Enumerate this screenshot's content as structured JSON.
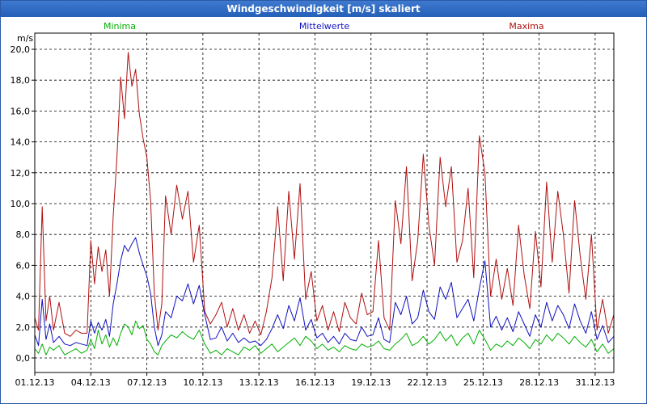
{
  "window": {
    "title": "Windgeschwindigkeit [m/s] skaliert"
  },
  "chart_data": {
    "type": "line",
    "title": "Windgeschwindigkeit [m/s] skaliert",
    "ylabel": "m/s",
    "xlabel": "",
    "ylim": [
      0,
      20
    ],
    "y_ticks": [
      "0,0",
      "2,0",
      "4,0",
      "6,0",
      "8,0",
      "10,0",
      "12,0",
      "14,0",
      "16,0",
      "18,0",
      "20,0"
    ],
    "x_ticks": [
      "01.12.13",
      "04.12.13",
      "07.12.13",
      "10.12.13",
      "13.12.13",
      "16.12.13",
      "19.12.13",
      "22.12.13",
      "25.12.13",
      "28.12.13",
      "31.12.13"
    ],
    "x_tick_days": [
      1,
      4,
      7,
      10,
      13,
      16,
      19,
      22,
      25,
      28,
      31
    ],
    "x_range_days": [
      1,
      32
    ],
    "grid": true,
    "legend_position": "top",
    "series": [
      {
        "name": "Minima",
        "color": "#00b000",
        "x_days": [
          1.0,
          1.2,
          1.4,
          1.6,
          1.8,
          2.0,
          2.3,
          2.6,
          2.9,
          3.2,
          3.5,
          3.8,
          4.0,
          4.2,
          4.4,
          4.6,
          4.8,
          5.0,
          5.2,
          5.4,
          5.6,
          5.8,
          6.0,
          6.2,
          6.4,
          6.6,
          6.8,
          7.0,
          7.2,
          7.4,
          7.6,
          7.8,
          8.0,
          8.3,
          8.6,
          8.9,
          9.2,
          9.5,
          9.8,
          10.1,
          10.4,
          10.7,
          11.0,
          11.3,
          11.6,
          11.9,
          12.2,
          12.5,
          12.8,
          13.1,
          13.4,
          13.7,
          14.0,
          14.3,
          14.6,
          14.9,
          15.2,
          15.5,
          15.8,
          16.1,
          16.4,
          16.7,
          17.0,
          17.3,
          17.6,
          17.9,
          18.2,
          18.5,
          18.8,
          19.1,
          19.4,
          19.7,
          20.0,
          20.3,
          20.6,
          20.9,
          21.2,
          21.5,
          21.8,
          22.1,
          22.4,
          22.7,
          23.0,
          23.3,
          23.6,
          23.9,
          24.2,
          24.5,
          24.8,
          25.1,
          25.4,
          25.7,
          26.0,
          26.3,
          26.6,
          26.9,
          27.2,
          27.5,
          27.8,
          28.1,
          28.4,
          28.7,
          29.0,
          29.3,
          29.6,
          29.9,
          30.2,
          30.5,
          30.8,
          31.1,
          31.4,
          31.7,
          32.0
        ],
        "values": [
          0.6,
          0.3,
          0.9,
          0.2,
          0.7,
          0.5,
          0.8,
          0.2,
          0.4,
          0.6,
          0.3,
          0.5,
          1.2,
          0.6,
          1.8,
          0.9,
          1.5,
          0.7,
          1.3,
          0.8,
          1.6,
          2.2,
          2.0,
          1.5,
          2.4,
          1.9,
          2.1,
          1.2,
          0.9,
          0.4,
          0.2,
          0.8,
          1.1,
          1.5,
          1.3,
          1.7,
          1.4,
          1.2,
          1.8,
          0.9,
          0.3,
          0.5,
          0.2,
          0.6,
          0.4,
          0.2,
          0.7,
          0.5,
          0.8,
          0.3,
          0.6,
          0.9,
          0.4,
          0.7,
          1.0,
          1.3,
          0.8,
          1.4,
          1.1,
          0.6,
          0.9,
          0.5,
          0.7,
          0.4,
          0.8,
          0.6,
          0.5,
          0.9,
          0.7,
          0.8,
          1.1,
          0.6,
          0.5,
          0.9,
          1.2,
          1.6,
          0.8,
          1.0,
          1.4,
          0.9,
          1.2,
          1.7,
          1.1,
          1.5,
          0.8,
          1.3,
          1.6,
          0.9,
          1.8,
          1.2,
          0.5,
          0.9,
          0.7,
          1.1,
          0.8,
          1.3,
          1.0,
          0.6,
          1.2,
          0.9,
          1.5,
          1.1,
          1.6,
          1.3,
          0.9,
          1.4,
          1.0,
          0.7,
          1.2,
          0.4,
          0.9,
          0.3,
          0.6
        ]
      },
      {
        "name": "Mittelwerte",
        "color": "#1010c0",
        "x_days": [
          1.0,
          1.2,
          1.4,
          1.6,
          1.8,
          2.0,
          2.3,
          2.6,
          2.9,
          3.2,
          3.5,
          3.8,
          4.0,
          4.2,
          4.4,
          4.6,
          4.8,
          5.0,
          5.2,
          5.4,
          5.6,
          5.8,
          6.0,
          6.2,
          6.4,
          6.6,
          6.8,
          7.0,
          7.2,
          7.4,
          7.6,
          7.8,
          8.0,
          8.3,
          8.6,
          8.9,
          9.2,
          9.5,
          9.8,
          10.1,
          10.4,
          10.7,
          11.0,
          11.3,
          11.6,
          11.9,
          12.2,
          12.5,
          12.8,
          13.1,
          13.4,
          13.7,
          14.0,
          14.3,
          14.6,
          14.9,
          15.2,
          15.5,
          15.8,
          16.1,
          16.4,
          16.7,
          17.0,
          17.3,
          17.6,
          17.9,
          18.2,
          18.5,
          18.8,
          19.1,
          19.4,
          19.7,
          20.0,
          20.3,
          20.6,
          20.9,
          21.2,
          21.5,
          21.8,
          22.1,
          22.4,
          22.7,
          23.0,
          23.3,
          23.6,
          23.9,
          24.2,
          24.5,
          24.8,
          25.1,
          25.4,
          25.7,
          26.0,
          26.3,
          26.6,
          26.9,
          27.2,
          27.5,
          27.8,
          28.1,
          28.4,
          28.7,
          29.0,
          29.3,
          29.6,
          29.9,
          30.2,
          30.5,
          30.8,
          31.1,
          31.4,
          31.7,
          32.0
        ],
        "values": [
          1.5,
          0.8,
          3.8,
          1.2,
          2.2,
          1.0,
          1.4,
          0.9,
          0.8,
          1.0,
          0.9,
          0.8,
          2.4,
          1.6,
          2.3,
          1.8,
          2.5,
          1.4,
          3.5,
          4.8,
          6.3,
          7.3,
          6.9,
          7.4,
          7.8,
          6.8,
          6.0,
          5.3,
          4.2,
          2.0,
          0.8,
          1.5,
          3.0,
          2.6,
          4.0,
          3.7,
          4.8,
          3.5,
          4.7,
          2.8,
          1.2,
          1.3,
          2.0,
          1.1,
          1.6,
          1.0,
          1.3,
          1.0,
          1.1,
          0.8,
          1.2,
          1.9,
          2.8,
          1.9,
          3.4,
          2.4,
          3.9,
          1.8,
          2.5,
          1.3,
          1.6,
          1.0,
          1.4,
          0.9,
          1.6,
          1.2,
          1.1,
          2.0,
          1.4,
          1.5,
          2.6,
          1.2,
          1.0,
          3.6,
          2.8,
          4.0,
          2.2,
          2.6,
          4.4,
          3.0,
          2.5,
          4.6,
          3.8,
          4.9,
          2.6,
          3.2,
          3.8,
          2.4,
          4.5,
          6.3,
          2.0,
          2.7,
          1.8,
          2.6,
          1.7,
          3.0,
          2.2,
          1.4,
          2.8,
          2.0,
          3.6,
          2.4,
          3.4,
          2.8,
          1.9,
          3.5,
          2.4,
          1.6,
          3.0,
          1.2,
          2.1,
          1.0,
          1.4
        ]
      },
      {
        "name": "Maxima",
        "color": "#b01010",
        "x_days": [
          1.0,
          1.2,
          1.4,
          1.6,
          1.8,
          2.0,
          2.3,
          2.6,
          2.9,
          3.2,
          3.5,
          3.8,
          4.0,
          4.2,
          4.4,
          4.6,
          4.8,
          5.0,
          5.2,
          5.4,
          5.6,
          5.8,
          6.0,
          6.2,
          6.4,
          6.6,
          6.8,
          7.0,
          7.2,
          7.4,
          7.6,
          7.8,
          8.0,
          8.3,
          8.6,
          8.9,
          9.2,
          9.5,
          9.8,
          10.1,
          10.4,
          10.7,
          11.0,
          11.3,
          11.6,
          11.9,
          12.2,
          12.5,
          12.8,
          13.1,
          13.4,
          13.7,
          14.0,
          14.3,
          14.6,
          14.9,
          15.2,
          15.5,
          15.8,
          16.1,
          16.4,
          16.7,
          17.0,
          17.3,
          17.6,
          17.9,
          18.2,
          18.5,
          18.8,
          19.1,
          19.4,
          19.7,
          20.0,
          20.3,
          20.6,
          20.9,
          21.2,
          21.5,
          21.8,
          22.1,
          22.4,
          22.7,
          23.0,
          23.3,
          23.6,
          23.9,
          24.2,
          24.5,
          24.8,
          25.1,
          25.4,
          25.7,
          26.0,
          26.3,
          26.6,
          26.9,
          27.2,
          27.5,
          27.8,
          28.1,
          28.4,
          28.7,
          29.0,
          29.3,
          29.6,
          29.9,
          30.2,
          30.5,
          30.8,
          31.1,
          31.4,
          31.7,
          32.0
        ],
        "values": [
          2.6,
          1.8,
          9.8,
          2.4,
          4.0,
          1.8,
          3.6,
          1.6,
          1.4,
          1.8,
          1.6,
          1.6,
          7.6,
          4.8,
          7.2,
          5.6,
          7.0,
          4.0,
          9.2,
          13.0,
          18.2,
          15.5,
          19.8,
          17.6,
          18.7,
          15.8,
          14.2,
          13.0,
          10.2,
          4.2,
          1.8,
          3.5,
          10.5,
          8.0,
          11.2,
          9.0,
          10.8,
          6.2,
          8.6,
          3.0,
          2.2,
          2.8,
          3.6,
          2.0,
          3.2,
          1.8,
          2.8,
          1.6,
          2.4,
          1.5,
          3.0,
          5.2,
          9.8,
          5.0,
          10.8,
          6.4,
          11.3,
          3.8,
          5.6,
          2.4,
          3.4,
          1.8,
          3.0,
          1.7,
          3.6,
          2.6,
          2.2,
          4.2,
          2.8,
          3.0,
          7.6,
          2.6,
          1.8,
          10.2,
          7.4,
          12.4,
          5.0,
          7.6,
          13.2,
          8.6,
          6.0,
          13.0,
          9.8,
          12.4,
          6.2,
          7.6,
          11.0,
          5.2,
          14.4,
          12.0,
          4.0,
          6.4,
          3.8,
          5.8,
          3.4,
          8.6,
          5.4,
          3.2,
          8.2,
          4.6,
          11.4,
          6.2,
          10.8,
          8.0,
          4.2,
          10.2,
          6.6,
          3.8,
          8.0,
          1.8,
          3.8,
          1.6,
          2.8
        ]
      }
    ]
  }
}
